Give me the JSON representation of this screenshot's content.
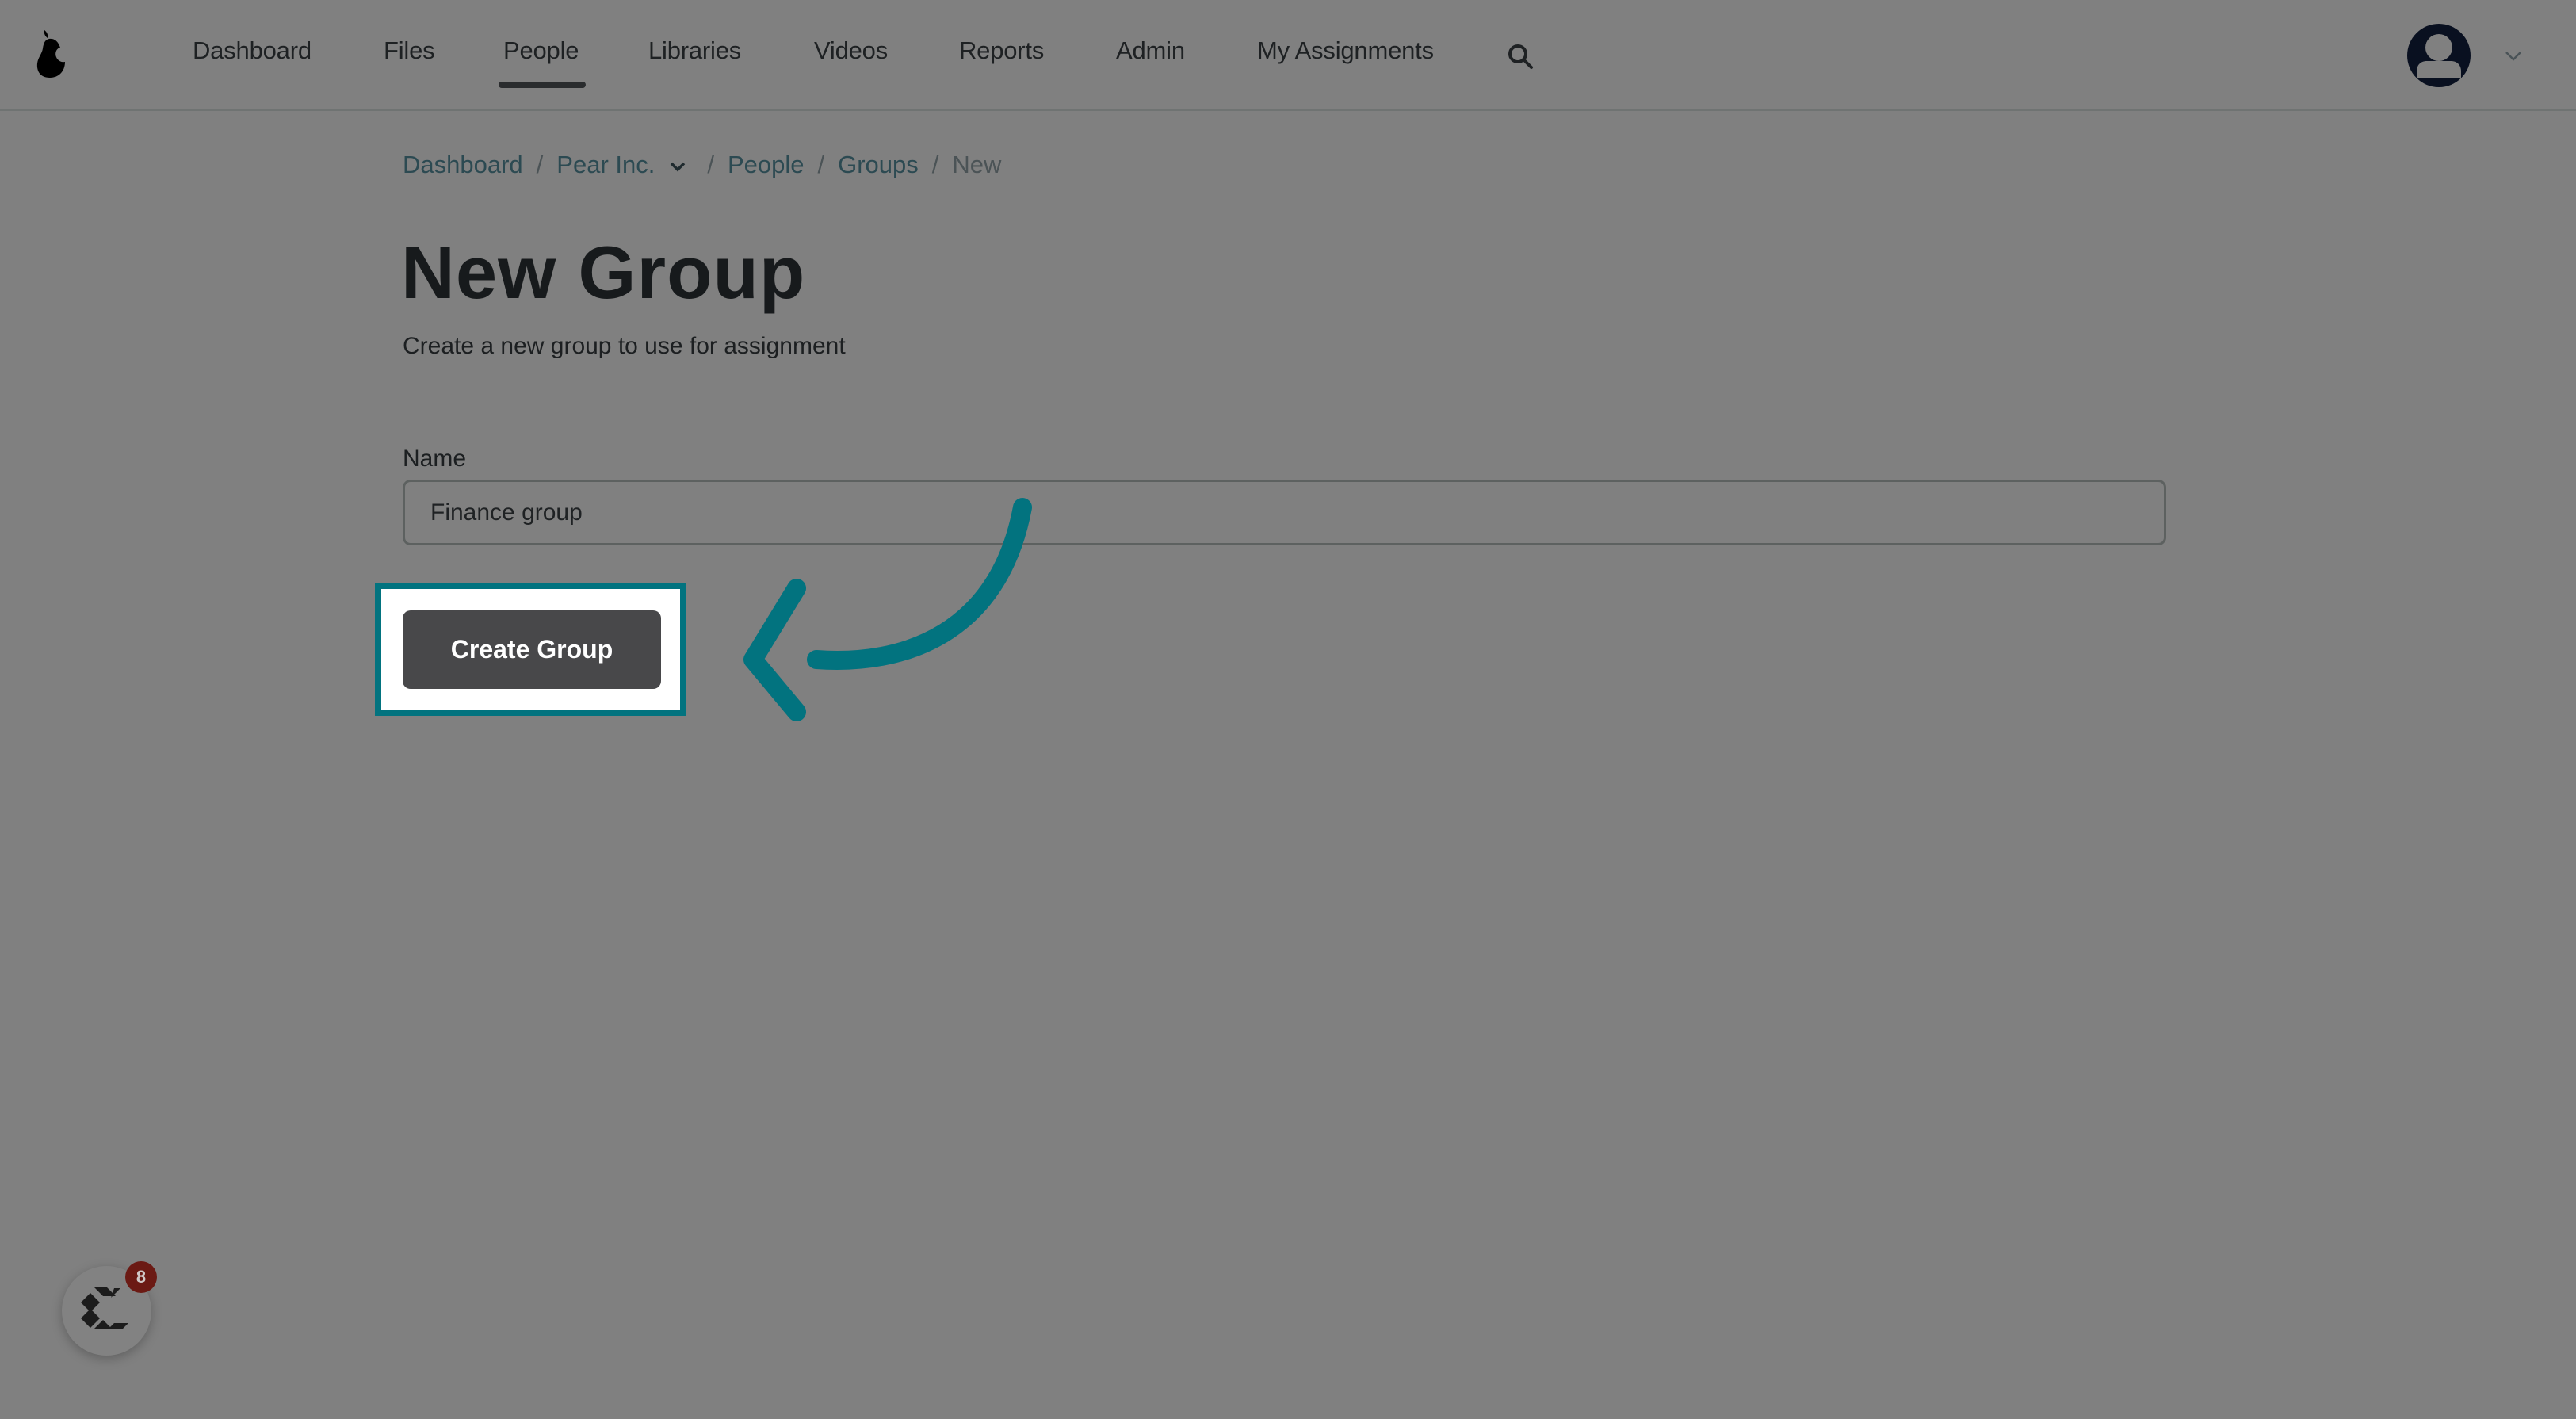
{
  "header": {
    "logo": "pear-logo-icon",
    "nav": [
      {
        "label": "Dashboard",
        "active": false
      },
      {
        "label": "Files",
        "active": false
      },
      {
        "label": "People",
        "active": true
      },
      {
        "label": "Libraries",
        "active": false
      },
      {
        "label": "Videos",
        "active": false
      },
      {
        "label": "Reports",
        "active": false
      },
      {
        "label": "Admin",
        "active": false
      },
      {
        "label": "My Assignments",
        "active": false
      }
    ],
    "search_icon": "search-icon",
    "avatar_icon": "user-avatar-icon",
    "avatar_menu_icon": "chevron-down-icon"
  },
  "breadcrumb": {
    "items": [
      "Dashboard",
      "Pear Inc.",
      "People",
      "Groups",
      "New"
    ],
    "separator": "/"
  },
  "page": {
    "title": "New Group",
    "subtitle": "Create a new group to use for assignment"
  },
  "form": {
    "name_label": "Name",
    "name_value": "Finance group",
    "submit_label": "Create Group"
  },
  "annotation": {
    "highlight_color": "#02737f",
    "arrow_color": "#02737f"
  },
  "chat_widget": {
    "icon": "chat-logo-icon",
    "badge_count": "8"
  },
  "colors": {
    "overlay_bg": "#808080",
    "button_bg": "#48484a",
    "badge_bg": "#6b1a14",
    "link": "#2c4a52"
  }
}
